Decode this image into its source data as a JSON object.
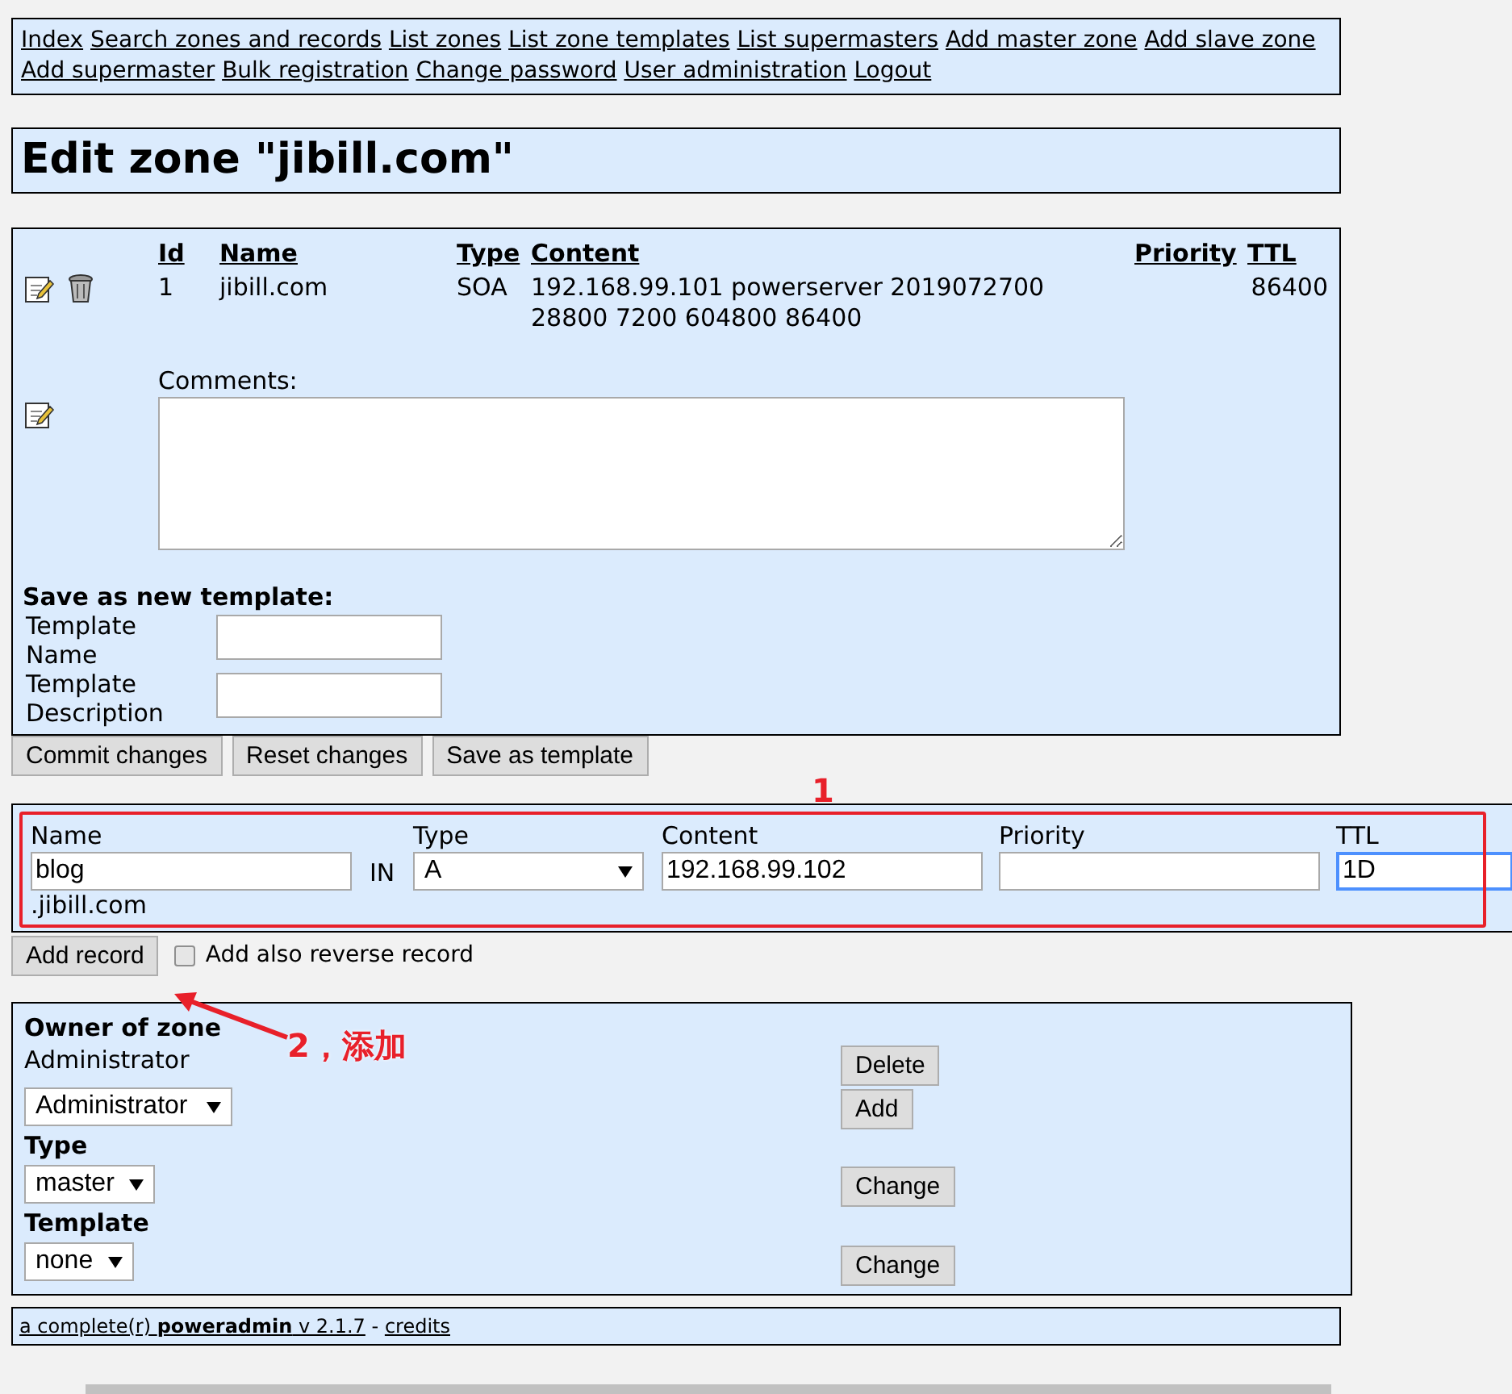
{
  "nav": {
    "links": [
      "Index",
      "Search zones and records",
      "List zones",
      "List zone templates",
      "List supermasters",
      "Add master zone",
      "Add slave zone",
      "Add supermaster",
      "Bulk registration",
      "Change password",
      "User administration",
      "Logout"
    ]
  },
  "title": "Edit zone \"jibill.com\"",
  "records": {
    "columns": [
      "Id",
      "Name",
      "Type",
      "Content",
      "Priority",
      "TTL"
    ],
    "rows": [
      {
        "id": "1",
        "name": "jibill.com",
        "type": "SOA",
        "content": "192.168.99.101 powerserver 2019072700 28800 7200 604800 86400",
        "ttl": "86400"
      }
    ],
    "comments_label": "Comments:"
  },
  "save_template": {
    "heading": "Save as new template:",
    "fields": [
      {
        "label": "Template Name"
      },
      {
        "label": "Template Description"
      }
    ]
  },
  "buttons": [
    "Commit changes",
    "Reset changes",
    "Save as template"
  ],
  "new_record": {
    "name_label": "Name",
    "name_value": "blog",
    "suffix": ".jibill.com",
    "class": "IN",
    "type_label": "Type",
    "type_value": "A",
    "content_label": "Content",
    "content_value": "192.168.99.102",
    "priority_label": "Priority",
    "ttl_label": "TTL",
    "ttl_value": "1D",
    "ttl_focused": true
  },
  "add_button": "Add record",
  "reverse": {
    "label": "Add also reverse record",
    "checked": false
  },
  "owner": {
    "heading": "Owner of zone",
    "owner_name": "Administrator",
    "delete_button": "Delete",
    "user_select": "Administrator",
    "add_button": "Add",
    "type_heading": "Type",
    "type_select": "master",
    "type_button": "Change",
    "template_heading": "Template",
    "template_select": "none",
    "template_button": "Change"
  },
  "footer": {
    "link": "a complete(r) **poweradmin** v 2.1.7",
    "separator": "-",
    "credits": "credits"
  },
  "annotations": [
    {
      "text": "1"
    },
    {
      "text": "2，添加"
    }
  ]
}
